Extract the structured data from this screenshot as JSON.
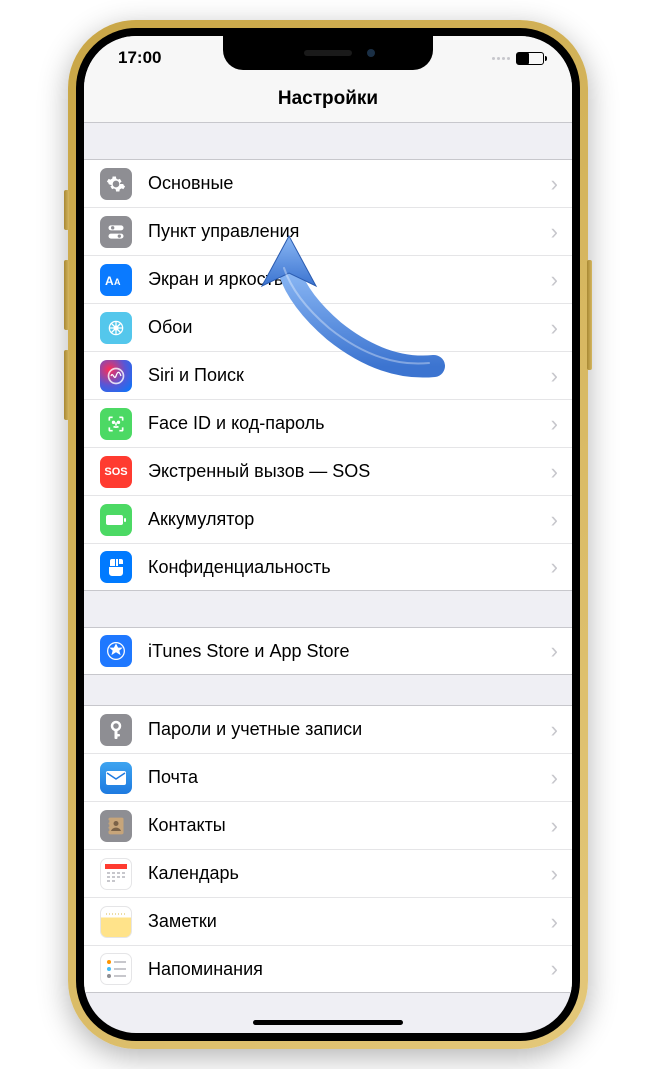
{
  "statusBar": {
    "time": "17:00"
  },
  "header": {
    "title": "Настройки"
  },
  "groups": [
    {
      "items": [
        {
          "key": "general",
          "label": "Основные",
          "iconName": "gear-icon"
        },
        {
          "key": "control",
          "label": "Пункт управления",
          "iconName": "toggles-icon"
        },
        {
          "key": "display",
          "label": "Экран и яркость",
          "iconName": "display-icon"
        },
        {
          "key": "wallpaper",
          "label": "Обои",
          "iconName": "wallpaper-icon"
        },
        {
          "key": "siri",
          "label": "Siri и Поиск",
          "iconName": "siri-icon"
        },
        {
          "key": "faceid",
          "label": "Face ID и код-пароль",
          "iconName": "faceid-icon"
        },
        {
          "key": "sos",
          "label": "Экстренный вызов — SOS",
          "iconName": "sos-icon",
          "iconText": "SOS"
        },
        {
          "key": "battery",
          "label": "Аккумулятор",
          "iconName": "battery-icon"
        },
        {
          "key": "privacy",
          "label": "Конфиденциальность",
          "iconName": "hand-icon"
        }
      ]
    },
    {
      "items": [
        {
          "key": "itunes",
          "label": "iTunes Store и App Store",
          "iconName": "appstore-icon"
        }
      ]
    },
    {
      "items": [
        {
          "key": "passwords",
          "label": "Пароли и учетные записи",
          "iconName": "key-icon"
        },
        {
          "key": "mail",
          "label": "Почта",
          "iconName": "mail-icon"
        },
        {
          "key": "contacts",
          "label": "Контакты",
          "iconName": "contacts-icon"
        },
        {
          "key": "calendar",
          "label": "Календарь",
          "iconName": "calendar-icon"
        },
        {
          "key": "notes",
          "label": "Заметки",
          "iconName": "notes-icon"
        },
        {
          "key": "reminders",
          "label": "Напоминания",
          "iconName": "reminders-icon"
        }
      ]
    }
  ],
  "overlay": {
    "arrowColor": "#4a8ae6"
  },
  "iconMap": {
    "general": "ic-general",
    "control": "ic-control",
    "display": "ic-display",
    "wallpaper": "ic-wallpaper",
    "siri": "ic-siri",
    "faceid": "ic-faceid",
    "sos": "ic-sos",
    "battery": "ic-battery",
    "privacy": "ic-privacy",
    "itunes": "ic-itunes",
    "passwords": "ic-passwords",
    "mail": "ic-mail",
    "contacts": "ic-contacts",
    "calendar": "ic-calendar",
    "notes": "ic-notes",
    "reminders": "ic-reminders"
  }
}
